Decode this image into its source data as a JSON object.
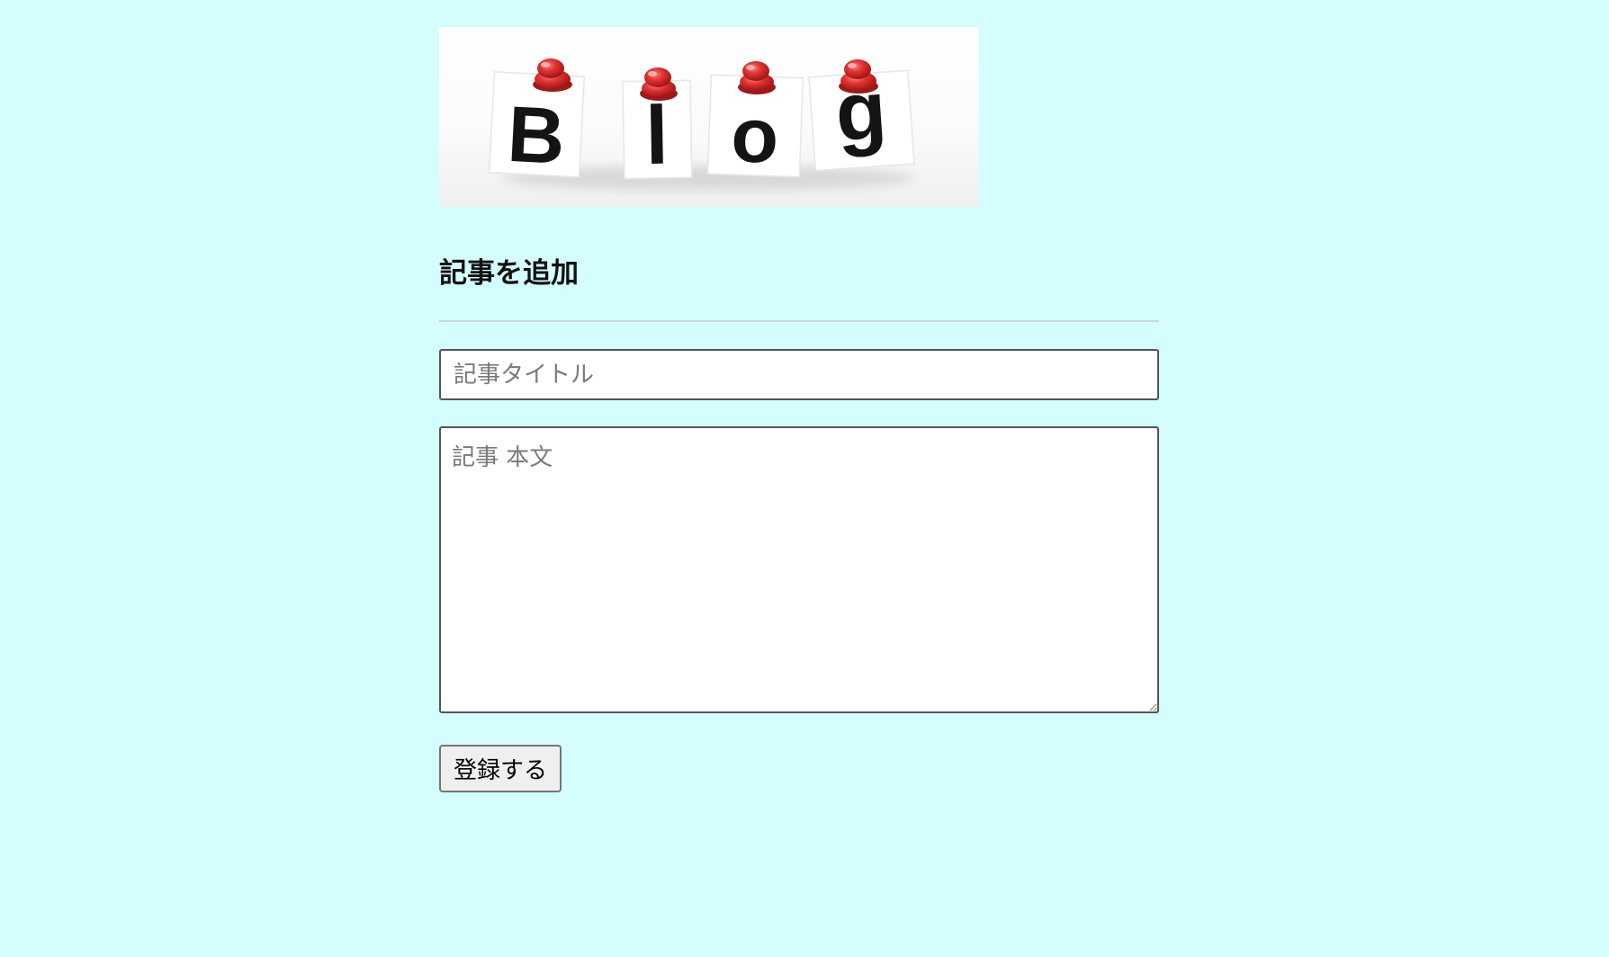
{
  "colors": {
    "page_background": "#d4fdfd",
    "pin_red": "#d92b2b"
  },
  "logo": {
    "alt": "Blog",
    "letters": [
      "B",
      "l",
      "o",
      "g"
    ],
    "icon": "pushpin-icon"
  },
  "form": {
    "heading": "記事を追加",
    "title_placeholder": "記事タイトル",
    "body_placeholder": "記事 本文",
    "submit_label": "登録する"
  }
}
